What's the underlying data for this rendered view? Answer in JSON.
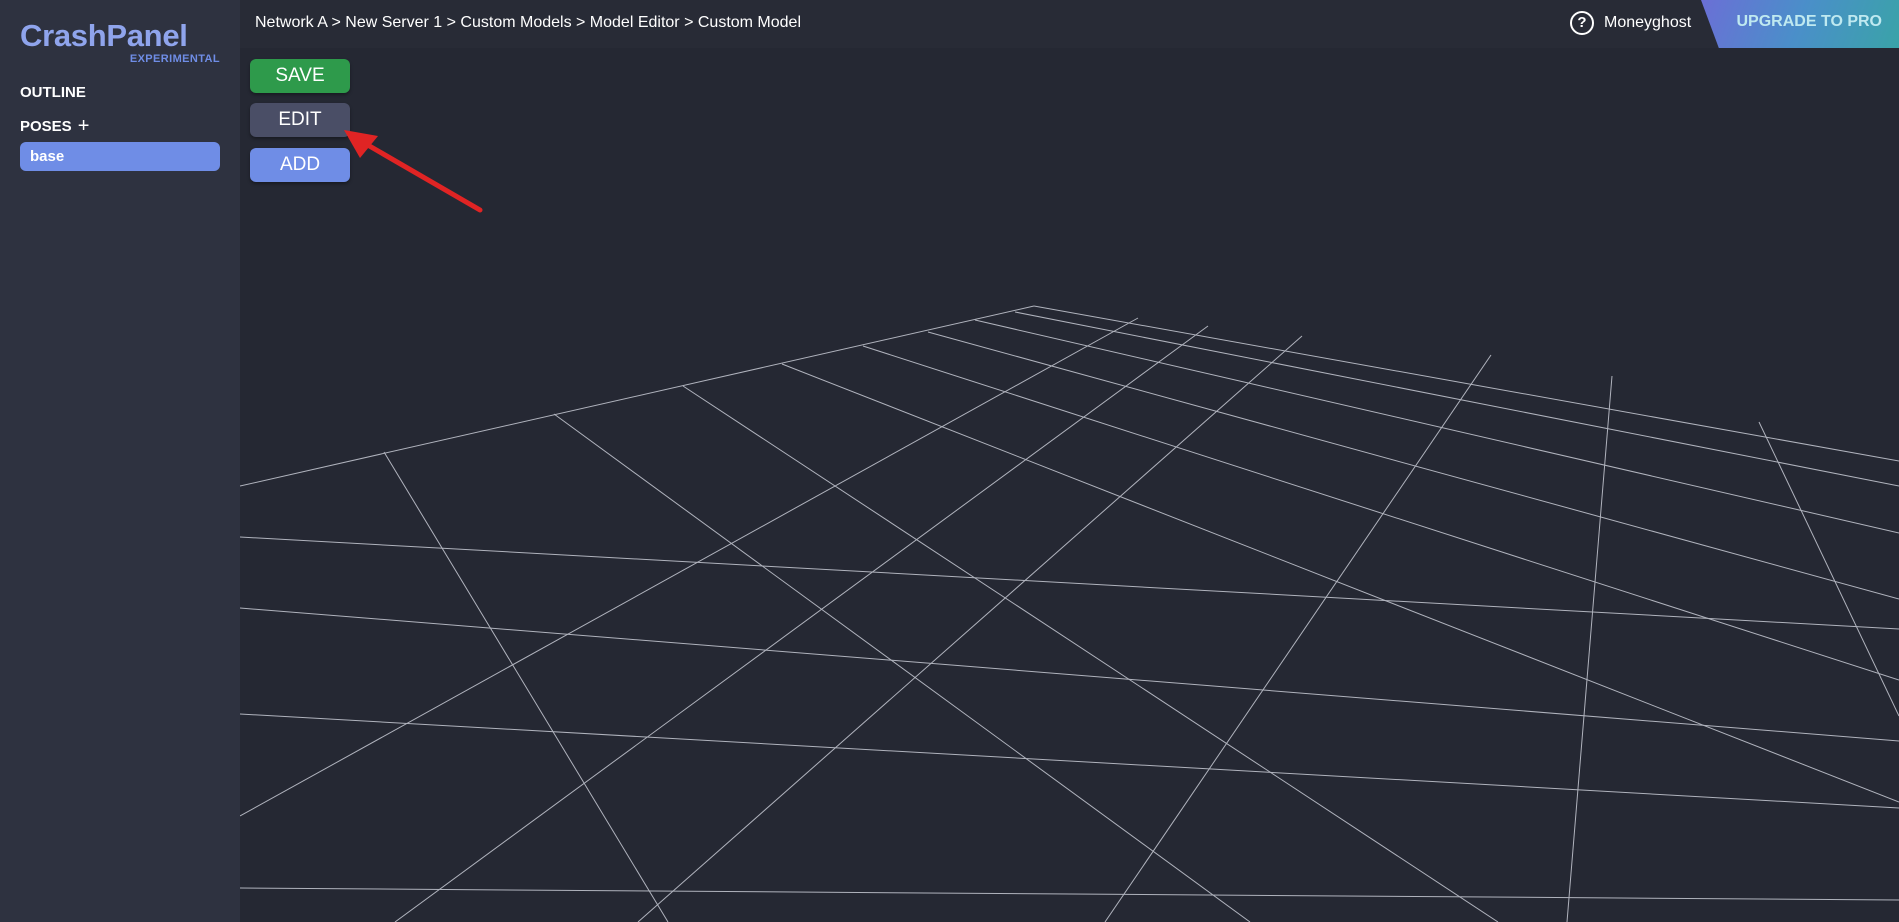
{
  "sidebar": {
    "brand_name": "CrashPanel",
    "brand_tag": "EXPERIMENTAL",
    "outline_label": "OUTLINE",
    "poses_label": "POSES",
    "poses_add_icon": "+",
    "poses": [
      {
        "label": "base",
        "selected": true
      }
    ]
  },
  "topbar": {
    "breadcrumb": "Network A > New Server 1 > Custom Models > Model Editor > Custom Model",
    "help_icon": "?",
    "username": "Moneyghost",
    "upgrade_label": "UPGRADE TO PRO"
  },
  "toolbar": {
    "save_label": "SAVE",
    "edit_label": "EDIT",
    "add_label": "ADD"
  },
  "colors": {
    "background": "#252833",
    "sidebar": "#2e3240",
    "accent": "#6f8de6",
    "save": "#2e9a4b",
    "edit": "#4a4e66",
    "annotation_arrow": "#e02424"
  }
}
